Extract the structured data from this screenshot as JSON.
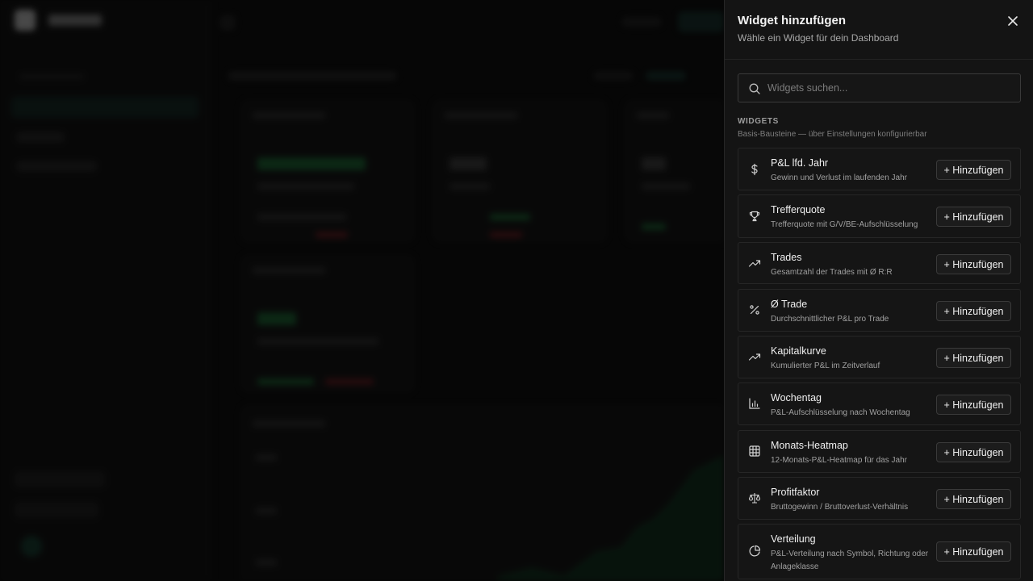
{
  "panel": {
    "title": "Widget hinzufügen",
    "subtitle": "Wähle ein Widget für dein Dashboard"
  },
  "search": {
    "placeholder": "Widgets suchen..."
  },
  "section": {
    "heading": "WIDGETS",
    "description": "Basis-Bausteine — über Einstellungen konfigurierbar"
  },
  "add_label": "+ Hinzufügen",
  "widgets": [
    {
      "name": "P&L lfd. Jahr",
      "description": "Gewinn und Verlust im laufenden Jahr",
      "icon": "dollar-icon"
    },
    {
      "name": "Trefferquote",
      "description": "Trefferquote mit G/V/BE-Aufschlüsselung",
      "icon": "trophy-icon"
    },
    {
      "name": "Trades",
      "description": "Gesamtzahl der Trades mit Ø R:R",
      "icon": "trending-up-icon"
    },
    {
      "name": "Ø Trade",
      "description": "Durchschnittlicher P&L pro Trade",
      "icon": "percent-icon"
    },
    {
      "name": "Kapitalkurve",
      "description": "Kumulierter P&L im Zeitverlauf",
      "icon": "trending-up-icon"
    },
    {
      "name": "Wochentag",
      "description": "P&L-Aufschlüsselung nach Wochentag",
      "icon": "bar-chart-icon"
    },
    {
      "name": "Monats-Heatmap",
      "description": "12-Monats-P&L-Heatmap für das Jahr",
      "icon": "grid-icon"
    },
    {
      "name": "Profitfaktor",
      "description": "Bruttogewinn / Bruttoverlust-Verhältnis",
      "icon": "scale-icon"
    },
    {
      "name": "Verteilung",
      "description": "P&L-Verteilung nach Symbol, Richtung oder Anlageklasse",
      "icon": "pie-chart-icon"
    }
  ],
  "colors": {
    "panel_bg": "#141414",
    "border": "#262626",
    "accent_green": "#1f7a3c",
    "accent_red": "#7a1f24"
  }
}
